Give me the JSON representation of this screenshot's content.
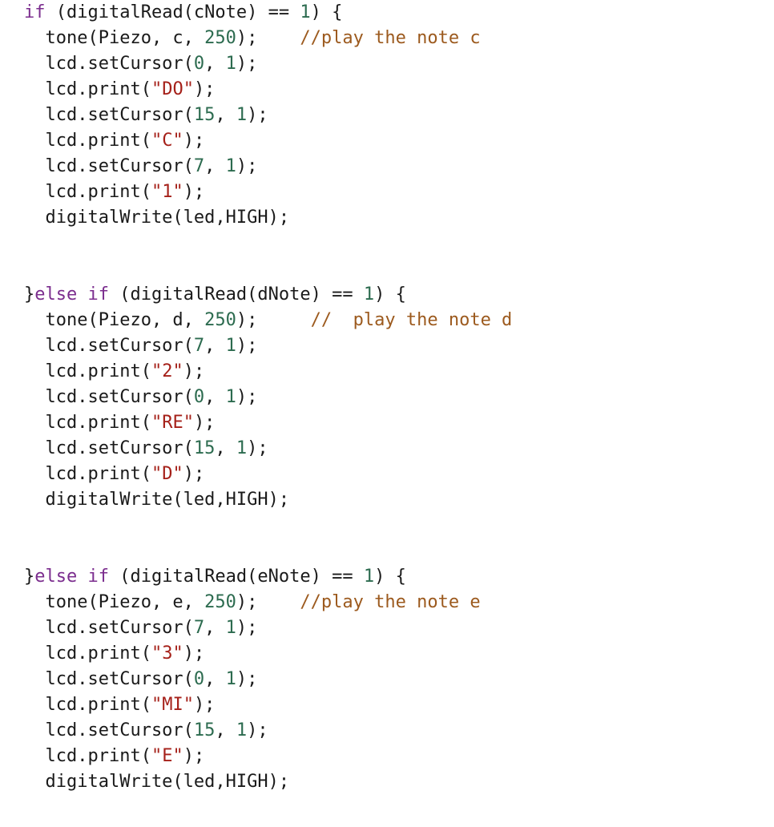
{
  "document": {
    "type": "source-code",
    "language": "arduino-c",
    "background_color": "#ffffff",
    "colors": {
      "plain": "#1a1a1a",
      "keyword": "#7B2D8E",
      "number": "#2C6B4F",
      "string": "#A52019",
      "comment": "#9C5A1E"
    },
    "lines": [
      {
        "id": "line-1",
        "tokens": [
          {
            "text": "if",
            "kind": "keyword"
          },
          {
            "text": " (digitalRead(cNote) == ",
            "kind": "plain"
          },
          {
            "text": "1",
            "kind": "number"
          },
          {
            "text": ") {",
            "kind": "plain"
          }
        ]
      },
      {
        "id": "line-2",
        "tokens": [
          {
            "text": "  tone(Piezo, c, ",
            "kind": "plain"
          },
          {
            "text": "250",
            "kind": "number"
          },
          {
            "text": ");    ",
            "kind": "plain"
          },
          {
            "text": "//play the note c",
            "kind": "comment"
          }
        ]
      },
      {
        "id": "line-3",
        "tokens": [
          {
            "text": "  lcd.setCursor(",
            "kind": "plain"
          },
          {
            "text": "0",
            "kind": "number"
          },
          {
            "text": ", ",
            "kind": "plain"
          },
          {
            "text": "1",
            "kind": "number"
          },
          {
            "text": ");",
            "kind": "plain"
          }
        ]
      },
      {
        "id": "line-4",
        "tokens": [
          {
            "text": "  lcd.print(",
            "kind": "plain"
          },
          {
            "text": "\"DO\"",
            "kind": "string"
          },
          {
            "text": ");",
            "kind": "plain"
          }
        ]
      },
      {
        "id": "line-5",
        "tokens": [
          {
            "text": "  lcd.setCursor(",
            "kind": "plain"
          },
          {
            "text": "15",
            "kind": "number"
          },
          {
            "text": ", ",
            "kind": "plain"
          },
          {
            "text": "1",
            "kind": "number"
          },
          {
            "text": ");",
            "kind": "plain"
          }
        ]
      },
      {
        "id": "line-6",
        "tokens": [
          {
            "text": "  lcd.print(",
            "kind": "plain"
          },
          {
            "text": "\"C\"",
            "kind": "string"
          },
          {
            "text": ");",
            "kind": "plain"
          }
        ]
      },
      {
        "id": "line-7",
        "tokens": [
          {
            "text": "  lcd.setCursor(",
            "kind": "plain"
          },
          {
            "text": "7",
            "kind": "number"
          },
          {
            "text": ", ",
            "kind": "plain"
          },
          {
            "text": "1",
            "kind": "number"
          },
          {
            "text": ");",
            "kind": "plain"
          }
        ]
      },
      {
        "id": "line-8",
        "tokens": [
          {
            "text": "  lcd.print(",
            "kind": "plain"
          },
          {
            "text": "\"1\"",
            "kind": "string"
          },
          {
            "text": ");",
            "kind": "plain"
          }
        ]
      },
      {
        "id": "line-9",
        "tokens": [
          {
            "text": "  digitalWrite(led,HIGH);",
            "kind": "plain"
          }
        ]
      },
      {
        "id": "line-10",
        "blank": true,
        "tokens": []
      },
      {
        "id": "line-11",
        "blank": true,
        "tokens": []
      },
      {
        "id": "line-12",
        "tokens": [
          {
            "text": "}",
            "kind": "plain"
          },
          {
            "text": "else",
            "kind": "keyword"
          },
          {
            "text": " ",
            "kind": "plain"
          },
          {
            "text": "if",
            "kind": "keyword"
          },
          {
            "text": " (digitalRead(dNote) == ",
            "kind": "plain"
          },
          {
            "text": "1",
            "kind": "number"
          },
          {
            "text": ") {",
            "kind": "plain"
          }
        ]
      },
      {
        "id": "line-13",
        "tokens": [
          {
            "text": "  tone(Piezo, d, ",
            "kind": "plain"
          },
          {
            "text": "250",
            "kind": "number"
          },
          {
            "text": ");     ",
            "kind": "plain"
          },
          {
            "text": "//  play the note d",
            "kind": "comment"
          }
        ]
      },
      {
        "id": "line-14",
        "tokens": [
          {
            "text": "  lcd.setCursor(",
            "kind": "plain"
          },
          {
            "text": "7",
            "kind": "number"
          },
          {
            "text": ", ",
            "kind": "plain"
          },
          {
            "text": "1",
            "kind": "number"
          },
          {
            "text": ");",
            "kind": "plain"
          }
        ]
      },
      {
        "id": "line-15",
        "tokens": [
          {
            "text": "  lcd.print(",
            "kind": "plain"
          },
          {
            "text": "\"2\"",
            "kind": "string"
          },
          {
            "text": ");",
            "kind": "plain"
          }
        ]
      },
      {
        "id": "line-16",
        "tokens": [
          {
            "text": "  lcd.setCursor(",
            "kind": "plain"
          },
          {
            "text": "0",
            "kind": "number"
          },
          {
            "text": ", ",
            "kind": "plain"
          },
          {
            "text": "1",
            "kind": "number"
          },
          {
            "text": ");",
            "kind": "plain"
          }
        ]
      },
      {
        "id": "line-17",
        "tokens": [
          {
            "text": "  lcd.print(",
            "kind": "plain"
          },
          {
            "text": "\"RE\"",
            "kind": "string"
          },
          {
            "text": ");",
            "kind": "plain"
          }
        ]
      },
      {
        "id": "line-18",
        "tokens": [
          {
            "text": "  lcd.setCursor(",
            "kind": "plain"
          },
          {
            "text": "15",
            "kind": "number"
          },
          {
            "text": ", ",
            "kind": "plain"
          },
          {
            "text": "1",
            "kind": "number"
          },
          {
            "text": ");",
            "kind": "plain"
          }
        ]
      },
      {
        "id": "line-19",
        "tokens": [
          {
            "text": "  lcd.print(",
            "kind": "plain"
          },
          {
            "text": "\"D\"",
            "kind": "string"
          },
          {
            "text": ");",
            "kind": "plain"
          }
        ]
      },
      {
        "id": "line-20",
        "tokens": [
          {
            "text": "  digitalWrite(led,HIGH);",
            "kind": "plain"
          }
        ]
      },
      {
        "id": "line-21",
        "blank": true,
        "tokens": []
      },
      {
        "id": "line-22",
        "blank": true,
        "tokens": []
      },
      {
        "id": "line-23",
        "tokens": [
          {
            "text": "}",
            "kind": "plain"
          },
          {
            "text": "else",
            "kind": "keyword"
          },
          {
            "text": " ",
            "kind": "plain"
          },
          {
            "text": "if",
            "kind": "keyword"
          },
          {
            "text": " (digitalRead(eNote) == ",
            "kind": "plain"
          },
          {
            "text": "1",
            "kind": "number"
          },
          {
            "text": ") {",
            "kind": "plain"
          }
        ]
      },
      {
        "id": "line-24",
        "tokens": [
          {
            "text": "  tone(Piezo, e, ",
            "kind": "plain"
          },
          {
            "text": "250",
            "kind": "number"
          },
          {
            "text": ");    ",
            "kind": "plain"
          },
          {
            "text": "//play the note e",
            "kind": "comment"
          }
        ]
      },
      {
        "id": "line-25",
        "tokens": [
          {
            "text": "  lcd.setCursor(",
            "kind": "plain"
          },
          {
            "text": "7",
            "kind": "number"
          },
          {
            "text": ", ",
            "kind": "plain"
          },
          {
            "text": "1",
            "kind": "number"
          },
          {
            "text": ");",
            "kind": "plain"
          }
        ]
      },
      {
        "id": "line-26",
        "tokens": [
          {
            "text": "  lcd.print(",
            "kind": "plain"
          },
          {
            "text": "\"3\"",
            "kind": "string"
          },
          {
            "text": ");",
            "kind": "plain"
          }
        ]
      },
      {
        "id": "line-27",
        "tokens": [
          {
            "text": "  lcd.setCursor(",
            "kind": "plain"
          },
          {
            "text": "0",
            "kind": "number"
          },
          {
            "text": ", ",
            "kind": "plain"
          },
          {
            "text": "1",
            "kind": "number"
          },
          {
            "text": ");",
            "kind": "plain"
          }
        ]
      },
      {
        "id": "line-28",
        "tokens": [
          {
            "text": "  lcd.print(",
            "kind": "plain"
          },
          {
            "text": "\"MI\"",
            "kind": "string"
          },
          {
            "text": ");",
            "kind": "plain"
          }
        ]
      },
      {
        "id": "line-29",
        "tokens": [
          {
            "text": "  lcd.setCursor(",
            "kind": "plain"
          },
          {
            "text": "15",
            "kind": "number"
          },
          {
            "text": ", ",
            "kind": "plain"
          },
          {
            "text": "1",
            "kind": "number"
          },
          {
            "text": ");",
            "kind": "plain"
          }
        ]
      },
      {
        "id": "line-30",
        "tokens": [
          {
            "text": "  lcd.print(",
            "kind": "plain"
          },
          {
            "text": "\"E\"",
            "kind": "string"
          },
          {
            "text": ");",
            "kind": "plain"
          }
        ]
      },
      {
        "id": "line-31",
        "tokens": [
          {
            "text": "  digitalWrite(led,HIGH);",
            "kind": "plain"
          }
        ]
      }
    ]
  }
}
